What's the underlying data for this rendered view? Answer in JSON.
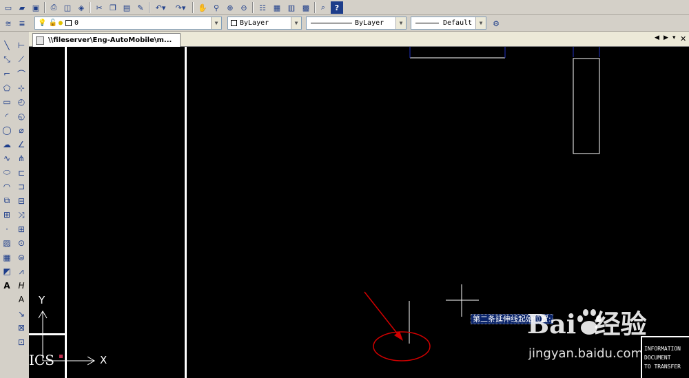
{
  "toolbar_top": {
    "icons": [
      "new-icon",
      "open-icon",
      "save-icon",
      "print-icon",
      "print-preview-icon",
      "publish-icon",
      "cut-icon",
      "copy-icon",
      "paste-icon",
      "match-properties-icon",
      "undo-icon",
      "redo-icon",
      "pan-icon",
      "zoom-realtime-icon",
      "zoom-window-icon",
      "zoom-previous-icon",
      "properties-icon",
      "design-center-icon",
      "tool-palettes-icon",
      "calculator-icon",
      "markup-icon",
      "help-icon"
    ]
  },
  "layers_toolbar": {
    "layer_name": "0",
    "color_value": "ByLayer",
    "linetype_value": "ByLayer",
    "lineweight_value": "Default"
  },
  "tab": {
    "title": "\\\\fileserver\\Eng-AutoMobile\\m..."
  },
  "canvas": {
    "prompt_text": "第二条延伸线起始位置:",
    "ucs_x_label": "X",
    "ucs_y_label": "Y",
    "ucs_text": "ICS",
    "title_block_lines": [
      "INFORMATION",
      "DOCUMENT",
      "TO TRANSFER"
    ]
  },
  "watermark": {
    "logo_text": "Bai  经验",
    "url": "jingyan.baidu.com"
  },
  "colors": {
    "background": "#000000",
    "highlight_annotation": "#d10000",
    "prompt_bg": "#0a246a"
  }
}
